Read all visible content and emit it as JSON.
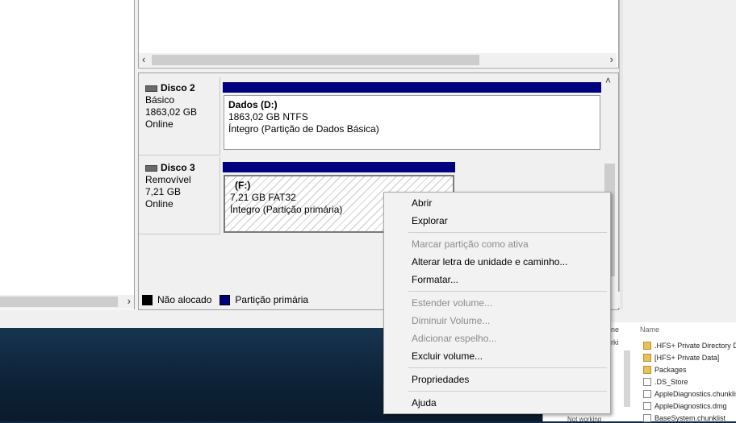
{
  "desktop": {
    "color": "#0f2a44"
  },
  "left_pane": {
    "scroll_right": "›"
  },
  "top_pane": {
    "scroll_left": "‹",
    "scroll_right": "›"
  },
  "vscroll": {
    "up": "˄"
  },
  "disks": [
    {
      "name": "Disco 2",
      "type": "Básico",
      "size": "1863,02 GB",
      "status": "Online",
      "partition": {
        "title": "Dados  (D:)",
        "fs": "1863,02 GB NTFS",
        "health": "Íntegro (Partição de Dados Básica)"
      }
    },
    {
      "name": "Disco 3",
      "type": "Removível",
      "size": "7,21 GB",
      "status": "Online",
      "partition": {
        "title": "(F:)",
        "fs": "7,21 GB FAT32",
        "health": "Íntegro (Partição primária)"
      }
    }
  ],
  "legend": {
    "unallocated": "Não alocado",
    "primary": "Partição primária",
    "unallocated_color": "#000000",
    "primary_color": "#00007f"
  },
  "finder": {
    "header": "Name",
    "items": [
      {
        "label": ".HFS+ Private Directory Data",
        "icon": "folder"
      },
      {
        "label": "[HFS+ Private Data]",
        "icon": "folder"
      },
      {
        "label": "Packages",
        "icon": "folder"
      },
      {
        "label": ".DS_Store",
        "icon": "file"
      },
      {
        "label": "AppleDiagnostics.chunklist",
        "icon": "file"
      },
      {
        "label": "AppleDiagnostics.dmg",
        "icon": "file"
      },
      {
        "label": "BaseSystem.chunklist",
        "icon": "file"
      }
    ],
    "partial": [
      "ne",
      "rki",
      "Not working"
    ]
  },
  "context_menu": {
    "items": [
      {
        "label": "Abrir",
        "enabled": true
      },
      {
        "label": "Explorar",
        "enabled": true
      },
      {
        "label": "Marcar partição como ativa",
        "enabled": false
      },
      {
        "label": "Alterar letra de unidade e caminho...",
        "enabled": true
      },
      {
        "label": "Formatar...",
        "enabled": true
      },
      {
        "label": "Estender volume...",
        "enabled": false
      },
      {
        "label": "Diminuir Volume...",
        "enabled": false
      },
      {
        "label": "Adicionar espelho...",
        "enabled": false
      },
      {
        "label": "Excluir volume...",
        "enabled": true
      },
      {
        "label": "Propriedades",
        "enabled": true
      },
      {
        "label": "Ajuda",
        "enabled": true
      }
    ]
  }
}
